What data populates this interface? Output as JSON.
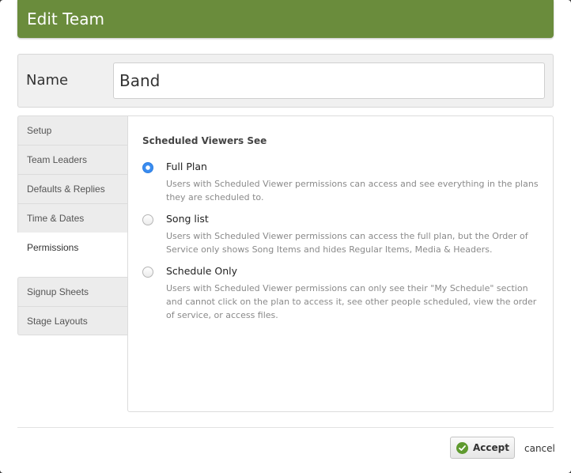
{
  "dialog": {
    "title": "Edit Team"
  },
  "name_field": {
    "label": "Name",
    "value": "Band"
  },
  "tabs": {
    "items": [
      {
        "label": "Setup"
      },
      {
        "label": "Team Leaders"
      },
      {
        "label": "Defaults & Replies"
      },
      {
        "label": "Time & Dates"
      },
      {
        "label": "Permissions",
        "active": true
      },
      {
        "label": "Signup Sheets"
      },
      {
        "label": "Stage Layouts"
      }
    ]
  },
  "permissions": {
    "section_title": "Scheduled Viewers See",
    "options": [
      {
        "label": "Full Plan",
        "checked": true,
        "description": "Users with Scheduled Viewer permissions can access and see everything in the plans they are scheduled to."
      },
      {
        "label": "Song list",
        "checked": false,
        "description": "Users with Scheduled Viewer permissions can access the full plan, but the Order of Service only shows Song Items and hides Regular Items, Media & Headers."
      },
      {
        "label": "Schedule Only",
        "checked": false,
        "description": "Users with Scheduled Viewer permissions can only see their \"My Schedule\" section and cannot click on the plan to access it, see other people scheduled, view the order of service, or access files."
      }
    ]
  },
  "footer": {
    "accept_label": "Accept",
    "cancel_label": "cancel"
  },
  "colors": {
    "titlebar": "#6a8c3c",
    "radio_selected": "#3a8cf0",
    "accept_icon": "#5f9a2f"
  }
}
